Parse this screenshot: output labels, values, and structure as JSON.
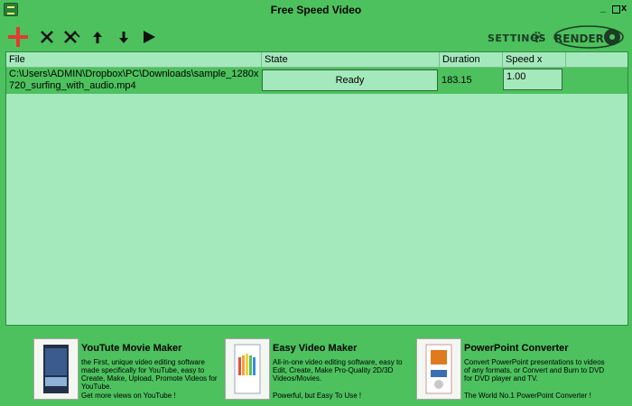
{
  "window": {
    "title": "Free Speed Video",
    "min_glyph": "_",
    "close_glyph": "x"
  },
  "toolbar": {
    "buttons": [
      {
        "name": "add",
        "icon": "plus-icon"
      },
      {
        "name": "remove",
        "icon": "x-icon"
      },
      {
        "name": "clear",
        "icon": "x-double-icon"
      },
      {
        "name": "move-up",
        "icon": "arrow-up-icon"
      },
      {
        "name": "move-down",
        "icon": "arrow-down-icon"
      },
      {
        "name": "play",
        "icon": "play-icon"
      }
    ],
    "settings_label": "Settings",
    "render_label": "Render"
  },
  "table": {
    "columns": [
      "File",
      "State",
      "Duration",
      "Speed x"
    ],
    "rows": [
      {
        "file": "C:\\Users\\ADMIN\\Dropbox\\PC\\Downloads\\sample_1280x720_surfing_with_audio.mp4",
        "state": "Ready",
        "duration": "183.15",
        "speed": "1.00"
      }
    ]
  },
  "promos": [
    {
      "title": "YouTute Movie Maker",
      "description": "the First, unique video editing software made specifically for YouTube, easy to Create, Make, Upload, Promote Videos for YouTube.",
      "tagline": "Get more views on YouTube !"
    },
    {
      "title": "Easy Video Maker",
      "description": "All-in-one video editing software, easy to Edit, Create, Make Pro-Quality 2D/3D Videos/Movies.",
      "tagline": "Powerful, but Easy To Use !"
    },
    {
      "title": "PowerPoint Converter",
      "description": "Convert PowerPoint presentations to videos of any formats, or Convert and Burn to DVD for DVD player and TV.",
      "tagline": "The World No.1 PowerPoint Converter !"
    }
  ],
  "colors": {
    "background": "#4cc15e",
    "panel": "#a4e9bc",
    "add_icon": "#e23a30"
  }
}
